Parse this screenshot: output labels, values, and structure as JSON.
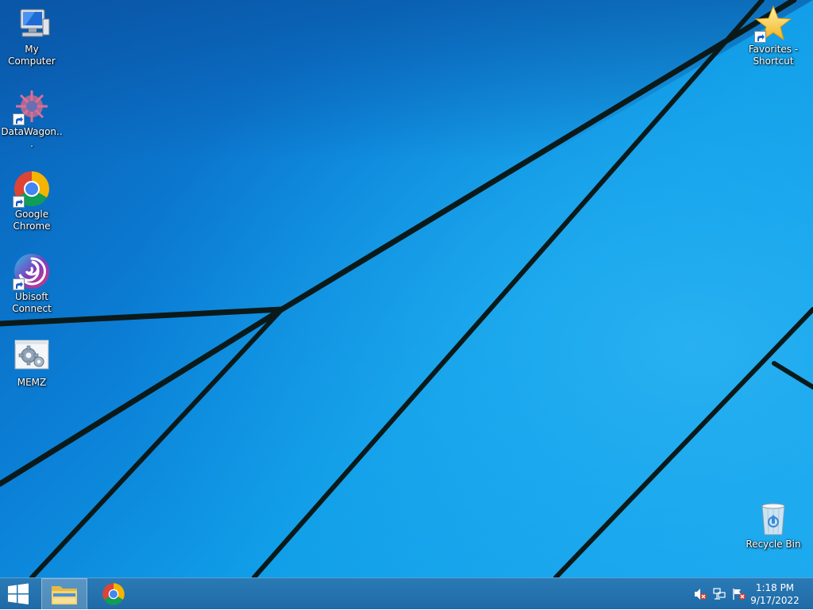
{
  "desktop": {
    "icons": [
      {
        "label": "My Computer",
        "icon": "computer-icon",
        "shortcut": false
      },
      {
        "label": "DataWagon...",
        "icon": "datawagon-icon",
        "shortcut": true
      },
      {
        "label": "Google Chrome",
        "icon": "chrome-icon",
        "shortcut": true
      },
      {
        "label": "Ubisoft Connect",
        "icon": "ubisoft-icon",
        "shortcut": true
      },
      {
        "label": "MEMZ",
        "icon": "settings-app-icon",
        "shortcut": false
      },
      {
        "label": "Favorites - Shortcut",
        "icon": "star-icon",
        "shortcut": true
      },
      {
        "label": "Recycle Bin",
        "icon": "recycle-bin-icon",
        "shortcut": false
      }
    ]
  },
  "taskbar": {
    "start": "windows-logo-icon",
    "pinned": [
      "file-explorer-icon",
      "chrome-icon"
    ],
    "tray": [
      "speaker-muted-icon",
      "network-error-icon",
      "action-center-flag-icon"
    ],
    "clock": {
      "time": "1:18 PM",
      "date": "9/17/2022"
    }
  },
  "colors": {
    "taskbar": "#2474b0",
    "wallpaper": "#109ee8",
    "lines": "#0a1a1a"
  }
}
